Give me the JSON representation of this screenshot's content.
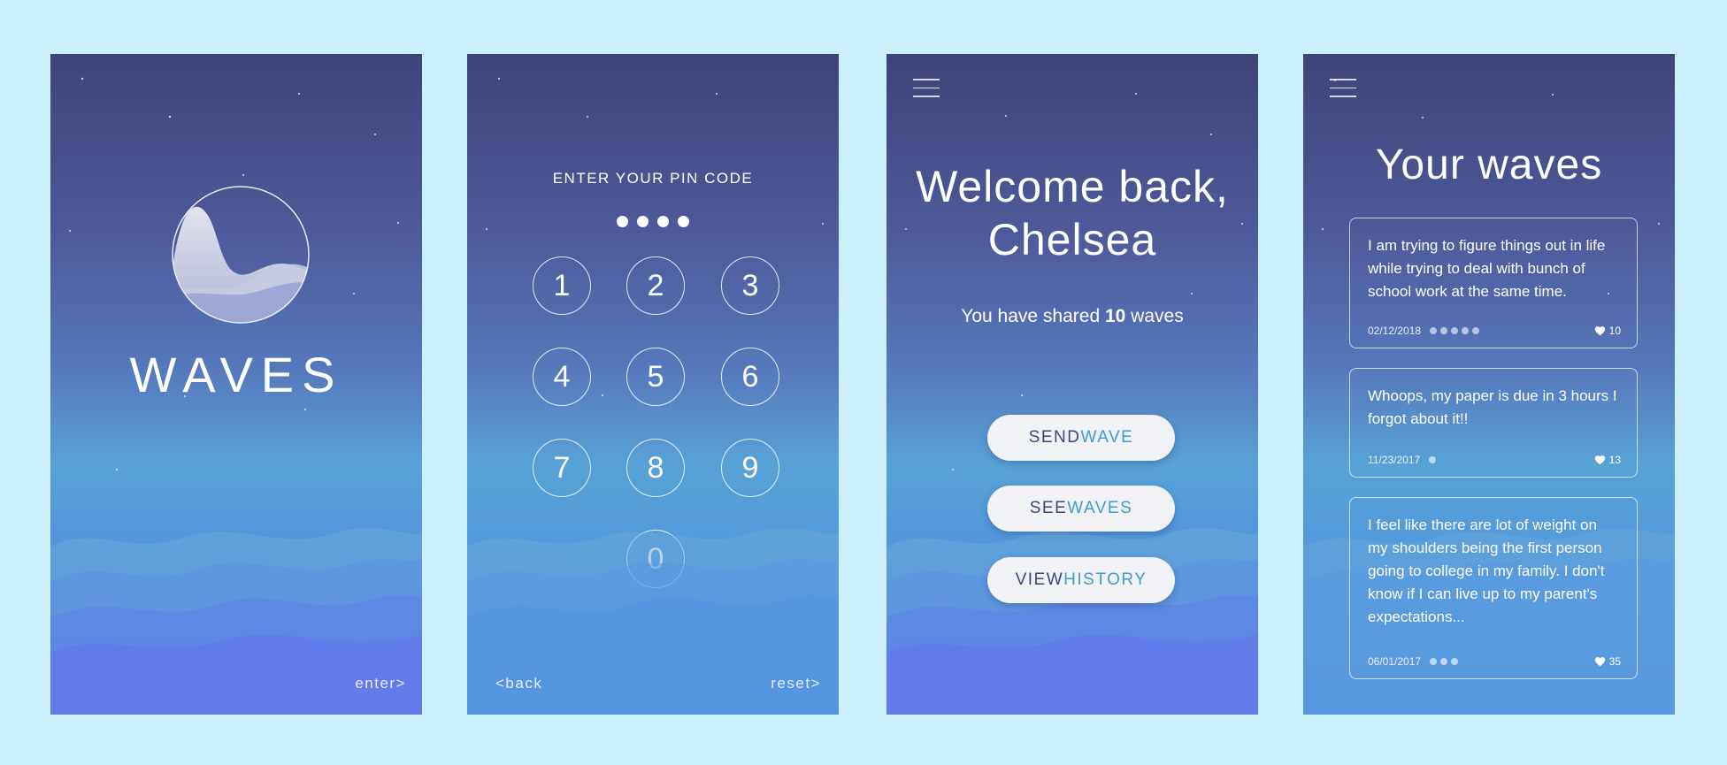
{
  "screen1": {
    "brand": "WAVES",
    "enter_link": "enter>"
  },
  "screen2": {
    "title": "ENTER YOUR PIN CODE",
    "pin_length": 4,
    "keys": [
      "1",
      "2",
      "3",
      "4",
      "5",
      "6",
      "7",
      "8",
      "9",
      "0"
    ],
    "back_link": "<back",
    "reset_link": "reset>"
  },
  "screen3": {
    "welcome_line1": "Welcome back,",
    "welcome_line2": "Chelsea",
    "shared_prefix": "You have shared ",
    "shared_count": "10",
    "shared_suffix": " waves",
    "buttons": [
      {
        "part1": "SEND ",
        "part2": "WAVE"
      },
      {
        "part1": "SEE ",
        "part2": "WAVES"
      },
      {
        "part1": "VIEW ",
        "part2": "HISTORY"
      }
    ]
  },
  "screen4": {
    "title": "Your waves",
    "cards": [
      {
        "text": "I am trying to figure things out in life while trying to deal with bunch of school work at the same time.",
        "date": "02/12/2018",
        "dots": 5,
        "likes": "10"
      },
      {
        "text": "Whoops, my paper is due in 3 hours I forgot about it!!",
        "date": "11/23/2017",
        "dots": 1,
        "likes": "13"
      },
      {
        "text": "I feel like there are lot of weight on my shoulders being the first person going to college in my family. I don't know if I can live up to my parent's expectations...",
        "date": "06/01/2017",
        "dots": 3,
        "likes": "35"
      }
    ]
  },
  "colors": {
    "page_background": "#cbf0fc",
    "screen_top": "#3f4379",
    "screen_bottom": "#6a78ef",
    "button_text": "#3c4680",
    "button_accent": "#3f9bd3"
  },
  "icons": [
    "waves-logo-icon",
    "menu-icon",
    "heart-icon"
  ]
}
